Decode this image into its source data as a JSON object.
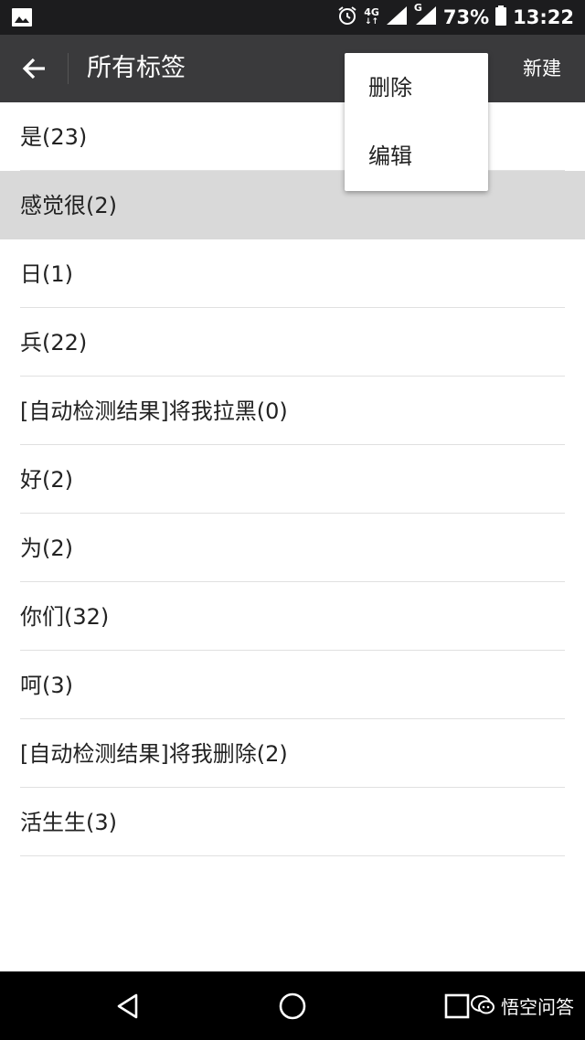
{
  "status_bar": {
    "network_top": "4G",
    "network_second": "G",
    "battery": "73%",
    "time": "13:22"
  },
  "app_bar": {
    "title": "所有标签",
    "new_label": "新建"
  },
  "tags": [
    {
      "label": "是(23)",
      "selected": false
    },
    {
      "label": "感觉很(2)",
      "selected": true
    },
    {
      "label": "日(1)",
      "selected": false
    },
    {
      "label": "兵(22)",
      "selected": false
    },
    {
      "label": "[自动检测结果]将我拉黑(0)",
      "selected": false
    },
    {
      "label": "好(2)",
      "selected": false
    },
    {
      "label": "为(2)",
      "selected": false
    },
    {
      "label": "你们(32)",
      "selected": false
    },
    {
      "label": "呵(3)",
      "selected": false
    },
    {
      "label": "[自动检测结果]将我删除(2)",
      "selected": false
    },
    {
      "label": "活生生(3)",
      "selected": false
    }
  ],
  "popup_menu": {
    "delete_label": "删除",
    "edit_label": "编辑"
  },
  "watermark": {
    "text": "悟空问答"
  },
  "colors": {
    "status_bar_bg": "#1c1c1e",
    "app_bar_bg": "#3a3a3c",
    "selected_row_bg": "#d9d9d9",
    "nav_bar_bg": "#000000"
  },
  "icons": {
    "status_left": "image-icon",
    "alarm": "alarm-icon",
    "signal": "signal-icon",
    "battery": "battery-icon",
    "back": "arrow-left-icon",
    "nav_back": "triangle-back-icon",
    "nav_home": "circle-home-icon",
    "nav_recent": "square-recent-icon"
  }
}
